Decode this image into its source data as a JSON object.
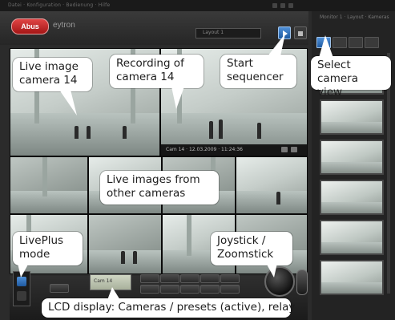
{
  "window": {
    "menu_text": "Datei · Konfiguration · Bedienung · Hilfe",
    "right_title": "Monitor 1 · Layout · Kameras"
  },
  "header": {
    "logo_text": "Abus",
    "brand": "eytron",
    "selector_value": "Layout 1",
    "sequencer_button_icon": "play-icon",
    "camera_view_button_icon": "grid-icon"
  },
  "recording": {
    "status_text": "Cam 14 · 12.03.2009 · 11:24:36"
  },
  "lcd": {
    "value": "Cam 14"
  },
  "callouts": {
    "live_image": "Live image\ncamera 14",
    "recording": "Recording of\ncamera 14",
    "start_sequencer": "Start\nsequencer",
    "select_camera_view": "Select\ncamera view",
    "live_other": "Live images from\nother cameras",
    "liveplus": "LivePlus\nmode",
    "joystick": "Joystick /\nZoomstick",
    "lcd_display": "LCD display: Cameras / presets (active), relay"
  },
  "colors": {
    "accent_blue": "#2f72c0",
    "logo_red": "#c42020",
    "panel_dark": "#2b2b2b",
    "callout_bg": "#ffffff"
  }
}
